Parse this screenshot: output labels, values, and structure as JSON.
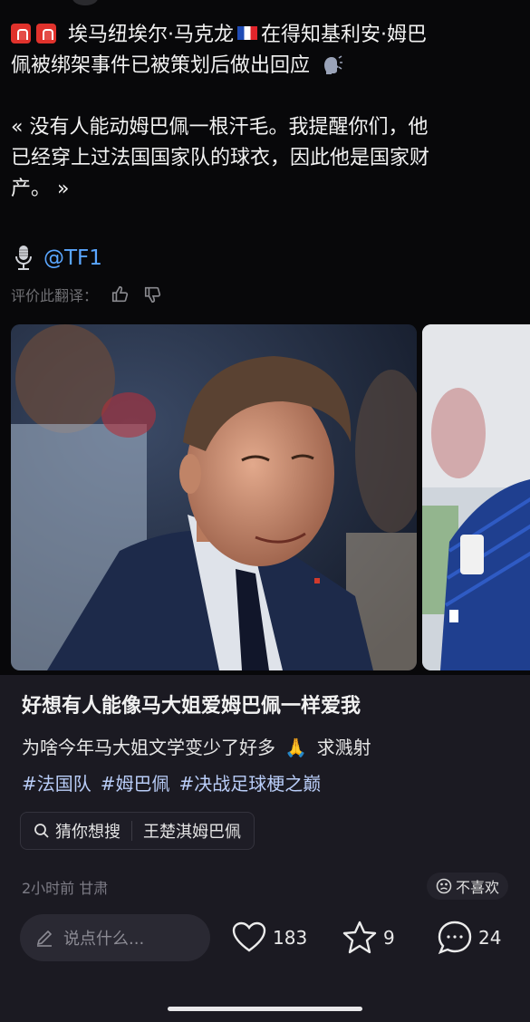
{
  "tweet": {
    "line1": "埃马纽埃尔·马克龙",
    "line1b": "在得知基利安·姆巴",
    "line2": "佩被绑架事件已被策划后做出回应",
    "quote_line1": "« 没有人能动姆巴佩一根汗毛。我提醒你们，他",
    "quote_line2": "已经穿上过法国国家队的球衣，因此他是国家财",
    "quote_line3": "产。 »",
    "source": "@TF1",
    "rate_label": "评价此翻译：",
    "icons": [
      "siren-icon",
      "france-flag-icon",
      "speaking-head-icon",
      "microphone-icon",
      "thumbs-up-icon",
      "thumbs-down-icon"
    ]
  },
  "post": {
    "title": "好想有人能像马大姐爱姆巴佩一样爱我",
    "desc_before": "为啥今年马大姐文学变少了好多",
    "desc_after": "求溅射",
    "pray_emoji": "🙏",
    "tags": [
      "#法国队",
      "#姆巴佩",
      "#决战足球梗之巅"
    ],
    "search_chip": {
      "label": "猜你想搜",
      "query": "王楚淇姆巴佩"
    },
    "meta": "2小时前 甘肃",
    "dislike_label": "不喜欢"
  },
  "bottom_bar": {
    "comment_placeholder": "说点什么...",
    "likes": "183",
    "stars": "9",
    "comments": "24"
  },
  "colors": {
    "background": "#000000",
    "post_bg": "#1b1a22",
    "link": "#5aa6ff",
    "tag": "#b9cdf8"
  }
}
